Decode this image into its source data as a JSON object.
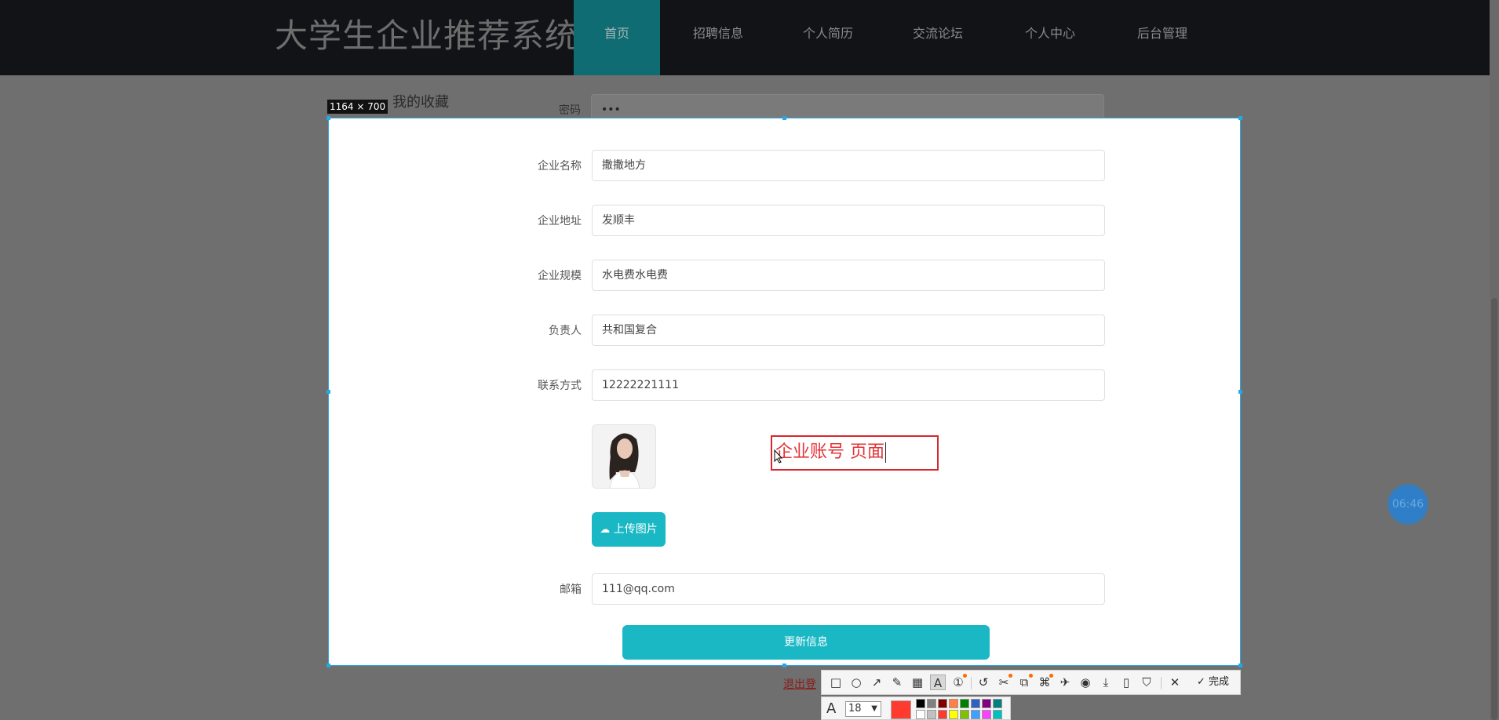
{
  "app": {
    "title": "大学生企业推荐系统"
  },
  "nav": {
    "items": [
      {
        "label": "首页",
        "active": true
      },
      {
        "label": "招聘信息"
      },
      {
        "label": "个人简历"
      },
      {
        "label": "交流论坛"
      },
      {
        "label": "个人中心"
      },
      {
        "label": "后台管理"
      }
    ]
  },
  "sidebar": {
    "title": "我的收藏"
  },
  "capture": {
    "dimensions": "1164 × 700"
  },
  "form": {
    "fields": [
      {
        "label": "密码",
        "value": "•••"
      },
      {
        "label": "企业名称",
        "value": "撒撒地方"
      },
      {
        "label": "企业地址",
        "value": "发顺丰"
      },
      {
        "label": "企业规模",
        "value": "水电费水电费"
      },
      {
        "label": "负责人",
        "value": "共和国复合"
      },
      {
        "label": "联系方式",
        "value": "12222221111"
      },
      {
        "label": "邮箱",
        "value": "111@qq.com"
      }
    ],
    "upload_label": "上传图片",
    "submit_label": "更新信息"
  },
  "annotation": {
    "text": "企业账号 页面",
    "color": "#e23438"
  },
  "logout": {
    "label": "退出登"
  },
  "timer": {
    "label": "06:46"
  },
  "toolbar": {
    "tools": [
      "rectangle-tool",
      "ellipse-tool",
      "arrow-tool",
      "pen-tool",
      "mosaic-tool",
      "text-tool",
      "number-tool",
      "undo-tool",
      "cutout-tool",
      "ocr-tool",
      "translate-tool",
      "pin-tool",
      "record-tool",
      "save-tool",
      "mobile-tool",
      "bookmark-tool",
      "cancel-tool"
    ],
    "finish_label": "完成",
    "font_size": "18",
    "current_color": "#ff3b30",
    "palette": [
      "#000000",
      "#808080",
      "#800000",
      "#ff8040",
      "#008000",
      "#3060c0",
      "#800080",
      "#008080",
      "#ffffff",
      "#c0c0c0",
      "#ff3b30",
      "#ffff00",
      "#80c000",
      "#40a0ff",
      "#ff40ff",
      "#00c0c0"
    ]
  }
}
